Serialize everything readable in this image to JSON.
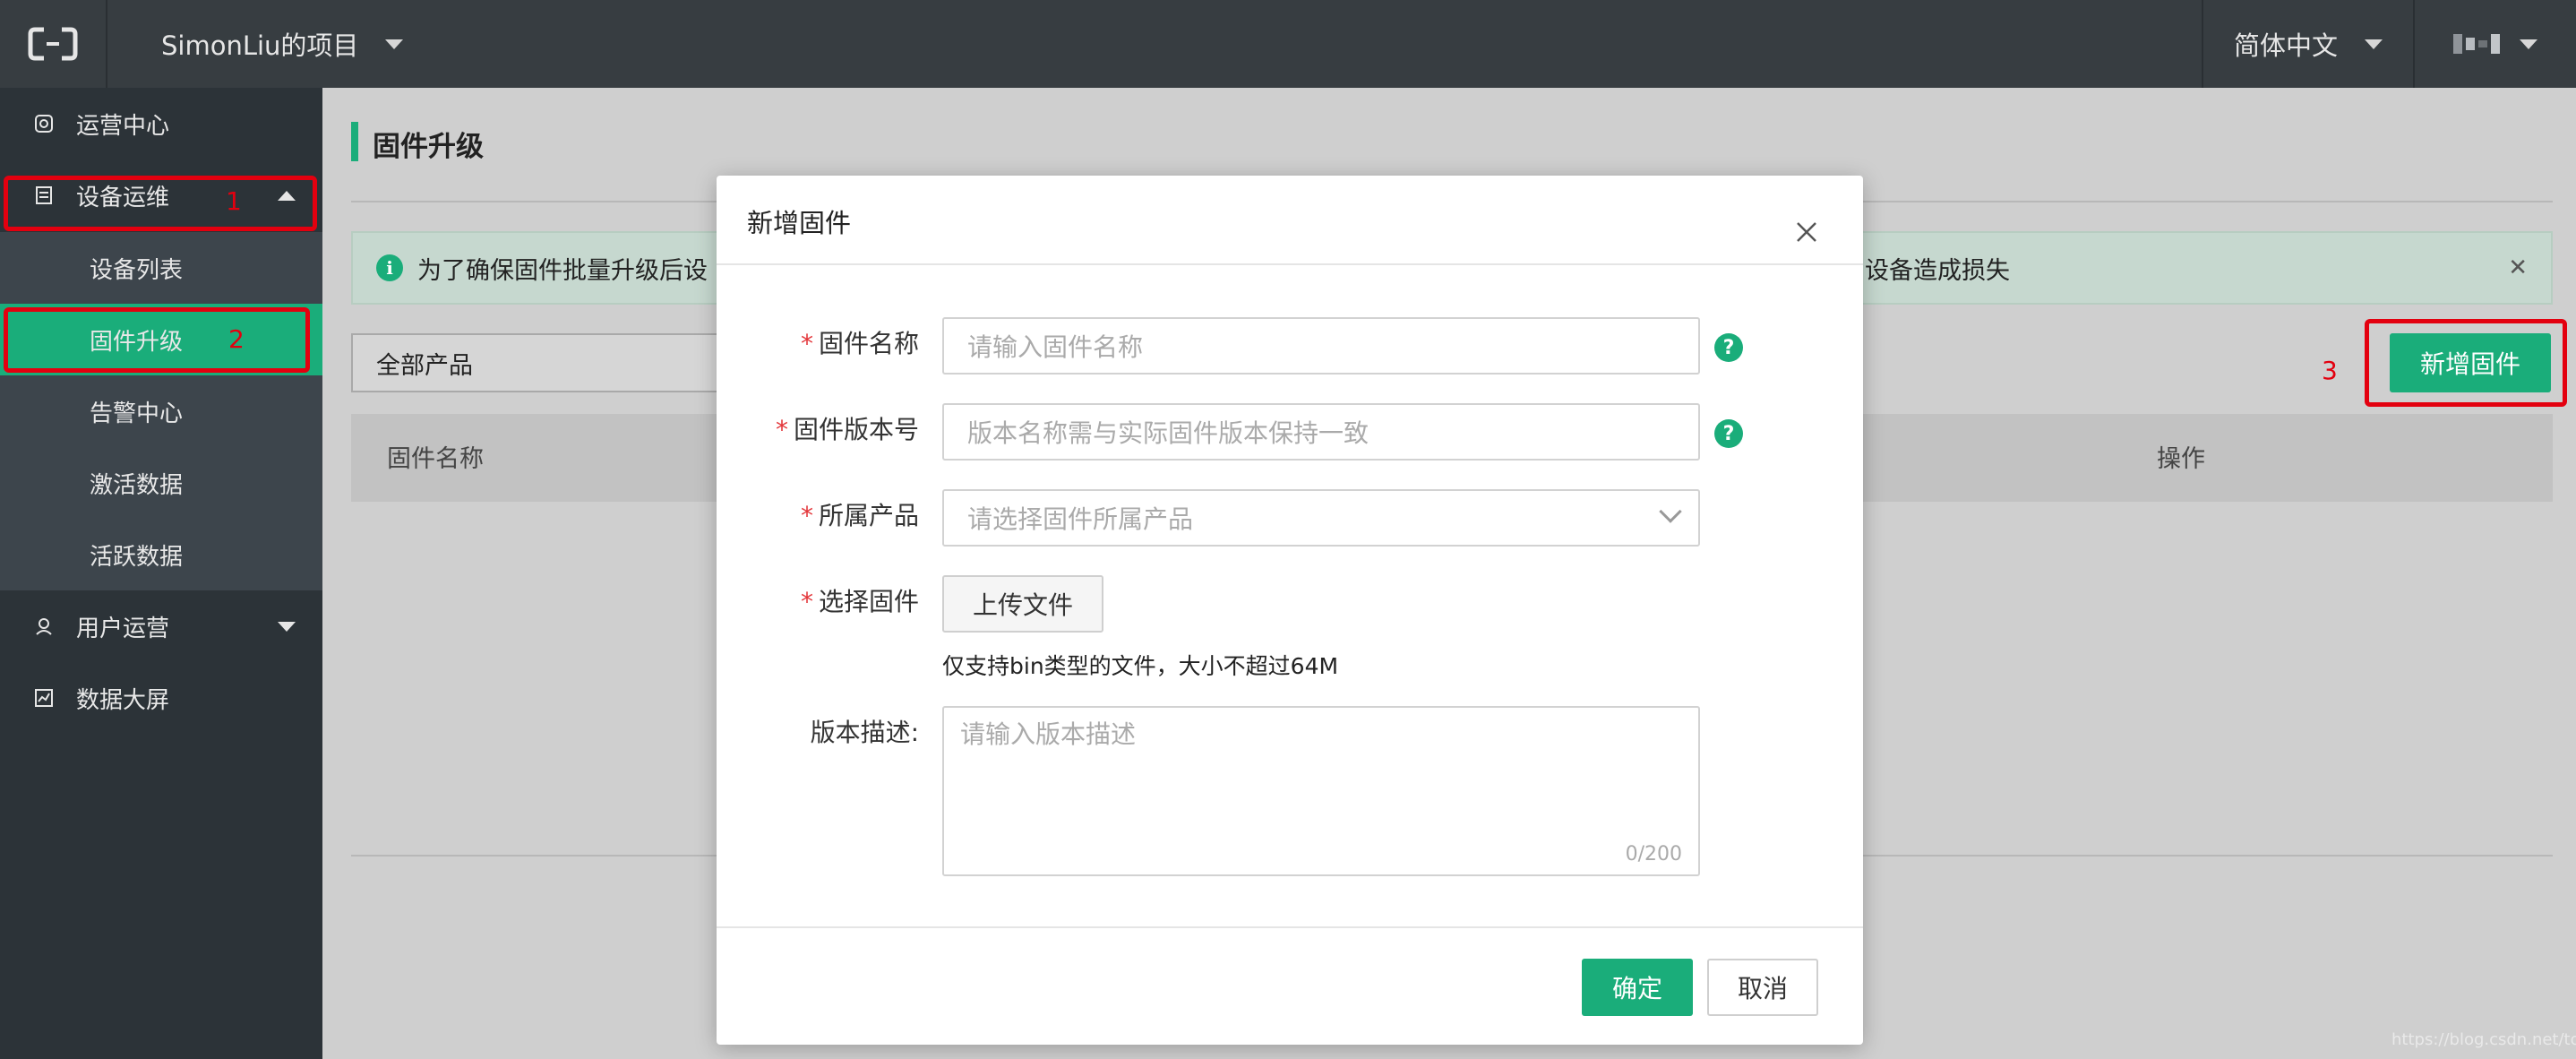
{
  "topbar": {
    "logo_icon": "alibaba-cloud-logo-icon",
    "project_name": "SimonLiu的项目",
    "language": "简体中文",
    "user_icon": "pixelated-username-icon"
  },
  "sidebar": {
    "items": [
      {
        "label": "运营中心",
        "icon": "dashboard-icon"
      },
      {
        "label": "设备运维",
        "icon": "device-icon",
        "expanded": true
      },
      {
        "label": "用户运营",
        "icon": "user-icon"
      },
      {
        "label": "数据大屏",
        "icon": "chart-icon"
      }
    ],
    "sub_items": [
      {
        "label": "设备列表"
      },
      {
        "label": "固件升级",
        "active": true
      },
      {
        "label": "告警中心"
      },
      {
        "label": "激活数据"
      },
      {
        "label": "活跃数据"
      }
    ]
  },
  "annotations": [
    "1",
    "2",
    "3"
  ],
  "main": {
    "title": "固件升级",
    "notice_left": "为了确保固件批量升级后设",
    "notice_right": "设备造成损失",
    "product_filter": "全部产品",
    "add_button": "新增固件",
    "columns": [
      "固件名称",
      "操作"
    ],
    "watermark": "https://blog.csdn.net/toopoo"
  },
  "modal": {
    "title": "新增固件",
    "fields": {
      "name": {
        "label": "固件名称",
        "placeholder": "请输入固件名称"
      },
      "version": {
        "label": "固件版本号",
        "placeholder": "版本名称需与实际固件版本保持一致"
      },
      "product": {
        "label": "所属产品",
        "placeholder": "请选择固件所属产品"
      },
      "file": {
        "label": "选择固件",
        "button": "上传文件",
        "hint": "仅支持bin类型的文件，大小不超过64M"
      },
      "desc": {
        "label": "版本描述:",
        "placeholder": "请输入版本描述",
        "counter": "0/200"
      }
    },
    "required_mark": "*",
    "help_mark": "?",
    "ok": "确定",
    "cancel": "取消"
  },
  "colors": {
    "accent": "#1aad7a",
    "topbar": "#373d41",
    "sidebar": "#2c3338",
    "annotation": "#e3000f"
  }
}
